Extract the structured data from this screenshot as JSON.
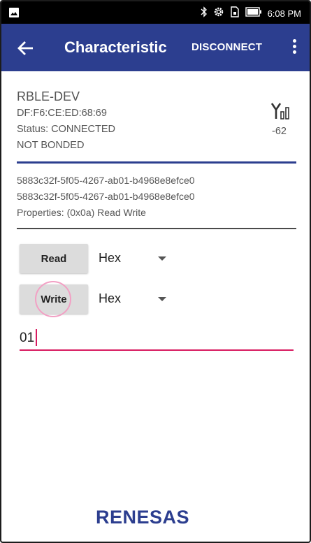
{
  "status_bar": {
    "time": "6:08 PM",
    "icons": [
      "image-icon",
      "bluetooth-icon",
      "settings-gear-icon",
      "sim-icon",
      "battery-icon"
    ]
  },
  "app_bar": {
    "title": "Characteristic",
    "disconnect_label": "DISCONNECT",
    "back_icon": "arrow-left-icon",
    "overflow_icon": "more-vert-icon",
    "color": "#2c3e8f"
  },
  "device": {
    "name": "RBLE-DEV",
    "address": "DF:F6:CE:ED:68:69",
    "status": "Status:  CONNECTED",
    "bond": "NOT BONDED",
    "rssi": "-62",
    "rssi_icon": "signal-antenna-icon"
  },
  "characteristic": {
    "service_uuid": "5883c32f-5f05-4267-ab01-b4968e8efce0",
    "char_uuid": "5883c32f-5f05-4267-ab01-b4968e8efce0",
    "properties": "Properties: (0x0a) Read Write"
  },
  "controls": {
    "read_label": "Read",
    "read_format": "Hex",
    "write_label": "Write",
    "write_format": "Hex",
    "write_value": "01"
  },
  "footer": {
    "logo_text": "RENESAS"
  },
  "colors": {
    "accent": "#d81b60",
    "touch_indicator": "#f2a0c4"
  }
}
